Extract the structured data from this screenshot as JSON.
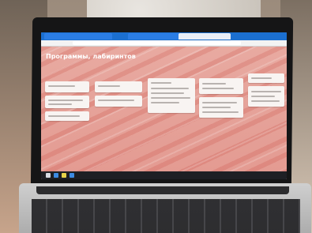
{
  "scene": {
    "title": "",
    "browser": {
      "tabs": [
        "",
        "",
        "",
        ""
      ],
      "url": ""
    },
    "page": {
      "breadcrumb": "",
      "title": "Программы, лабиринтов",
      "subtitle": ""
    },
    "taskbar": {
      "time": ""
    }
  }
}
